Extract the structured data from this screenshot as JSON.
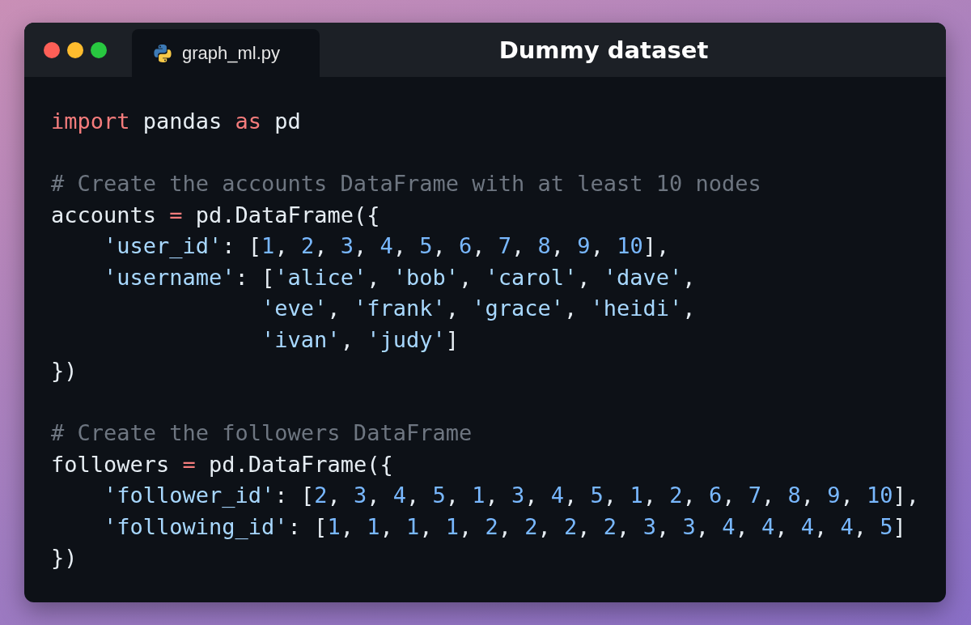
{
  "window": {
    "title": "Dummy dataset",
    "tab": {
      "label": "graph_ml.py"
    }
  },
  "code": [
    {
      "kind": "code",
      "tokens": [
        {
          "kind": "keyword",
          "text": "import"
        },
        {
          "kind": "plain",
          "text": " pandas "
        },
        {
          "kind": "keyword",
          "text": "as"
        },
        {
          "kind": "plain",
          "text": " pd"
        }
      ]
    },
    {
      "kind": "blank"
    },
    {
      "kind": "code",
      "tokens": [
        {
          "kind": "comment",
          "text": "# Create the accounts DataFrame with at least 10 nodes"
        }
      ]
    },
    {
      "kind": "code",
      "tokens": [
        {
          "kind": "plain",
          "text": "accounts "
        },
        {
          "kind": "operator",
          "text": "="
        },
        {
          "kind": "plain",
          "text": " pd.DataFrame({"
        }
      ]
    },
    {
      "kind": "nested",
      "tokens": [
        {
          "kind": "string",
          "text": "'user_id'"
        },
        {
          "kind": "plain",
          "text": ": ["
        },
        {
          "kind": "number",
          "text": "1"
        },
        {
          "kind": "plain",
          "text": ", "
        },
        {
          "kind": "number",
          "text": "2"
        },
        {
          "kind": "plain",
          "text": ", "
        },
        {
          "kind": "number",
          "text": "3"
        },
        {
          "kind": "plain",
          "text": ", "
        },
        {
          "kind": "number",
          "text": "4"
        },
        {
          "kind": "plain",
          "text": ", "
        },
        {
          "kind": "number",
          "text": "5"
        },
        {
          "kind": "plain",
          "text": ", "
        },
        {
          "kind": "number",
          "text": "6"
        },
        {
          "kind": "plain",
          "text": ", "
        },
        {
          "kind": "number",
          "text": "7"
        },
        {
          "kind": "plain",
          "text": ", "
        },
        {
          "kind": "number",
          "text": "8"
        },
        {
          "kind": "plain",
          "text": ", "
        },
        {
          "kind": "number",
          "text": "9"
        },
        {
          "kind": "plain",
          "text": ", "
        },
        {
          "kind": "number",
          "text": "10"
        },
        {
          "kind": "plain",
          "text": "],"
        }
      ]
    },
    {
      "kind": "nested",
      "tokens": [
        {
          "kind": "string",
          "text": "'username'"
        },
        {
          "kind": "plain",
          "text": ": ["
        },
        {
          "kind": "string",
          "text": "'alice'"
        },
        {
          "kind": "plain",
          "text": ", "
        },
        {
          "kind": "string",
          "text": "'bob'"
        },
        {
          "kind": "plain",
          "text": ", "
        },
        {
          "kind": "string",
          "text": "'carol'"
        },
        {
          "kind": "plain",
          "text": ", "
        },
        {
          "kind": "string",
          "text": "'dave'"
        },
        {
          "kind": "plain",
          "text": ","
        }
      ]
    },
    {
      "kind": "continued",
      "tokens": [
        {
          "kind": "string",
          "text": "'eve'"
        },
        {
          "kind": "plain",
          "text": ", "
        },
        {
          "kind": "string",
          "text": "'frank'"
        },
        {
          "kind": "plain",
          "text": ", "
        },
        {
          "kind": "string",
          "text": "'grace'"
        },
        {
          "kind": "plain",
          "text": ", "
        },
        {
          "kind": "string",
          "text": "'heidi'"
        },
        {
          "kind": "plain",
          "text": ","
        }
      ]
    },
    {
      "kind": "continued",
      "tokens": [
        {
          "kind": "string",
          "text": "'ivan'"
        },
        {
          "kind": "plain",
          "text": ", "
        },
        {
          "kind": "string",
          "text": "'judy'"
        },
        {
          "kind": "plain",
          "text": "]"
        }
      ]
    },
    {
      "kind": "code",
      "tokens": [
        {
          "kind": "plain",
          "text": "})"
        }
      ]
    },
    {
      "kind": "blank"
    },
    {
      "kind": "code",
      "tokens": [
        {
          "kind": "comment",
          "text": "# Create the followers DataFrame"
        }
      ]
    },
    {
      "kind": "code",
      "tokens": [
        {
          "kind": "plain",
          "text": "followers "
        },
        {
          "kind": "operator",
          "text": "="
        },
        {
          "kind": "plain",
          "text": " pd.DataFrame({"
        }
      ]
    },
    {
      "kind": "nested",
      "tokens": [
        {
          "kind": "string",
          "text": "'follower_id'"
        },
        {
          "kind": "plain",
          "text": ": ["
        },
        {
          "kind": "number",
          "text": "2"
        },
        {
          "kind": "plain",
          "text": ", "
        },
        {
          "kind": "number",
          "text": "3"
        },
        {
          "kind": "plain",
          "text": ", "
        },
        {
          "kind": "number",
          "text": "4"
        },
        {
          "kind": "plain",
          "text": ", "
        },
        {
          "kind": "number",
          "text": "5"
        },
        {
          "kind": "plain",
          "text": ", "
        },
        {
          "kind": "number",
          "text": "1"
        },
        {
          "kind": "plain",
          "text": ", "
        },
        {
          "kind": "number",
          "text": "3"
        },
        {
          "kind": "plain",
          "text": ", "
        },
        {
          "kind": "number",
          "text": "4"
        },
        {
          "kind": "plain",
          "text": ", "
        },
        {
          "kind": "number",
          "text": "5"
        },
        {
          "kind": "plain",
          "text": ", "
        },
        {
          "kind": "number",
          "text": "1"
        },
        {
          "kind": "plain",
          "text": ", "
        },
        {
          "kind": "number",
          "text": "2"
        },
        {
          "kind": "plain",
          "text": ", "
        },
        {
          "kind": "number",
          "text": "6"
        },
        {
          "kind": "plain",
          "text": ", "
        },
        {
          "kind": "number",
          "text": "7"
        },
        {
          "kind": "plain",
          "text": ", "
        },
        {
          "kind": "number",
          "text": "8"
        },
        {
          "kind": "plain",
          "text": ", "
        },
        {
          "kind": "number",
          "text": "9"
        },
        {
          "kind": "plain",
          "text": ", "
        },
        {
          "kind": "number",
          "text": "10"
        },
        {
          "kind": "plain",
          "text": "],"
        }
      ]
    },
    {
      "kind": "nested",
      "tokens": [
        {
          "kind": "string",
          "text": "'following_id'"
        },
        {
          "kind": "plain",
          "text": ": ["
        },
        {
          "kind": "number",
          "text": "1"
        },
        {
          "kind": "plain",
          "text": ", "
        },
        {
          "kind": "number",
          "text": "1"
        },
        {
          "kind": "plain",
          "text": ", "
        },
        {
          "kind": "number",
          "text": "1"
        },
        {
          "kind": "plain",
          "text": ", "
        },
        {
          "kind": "number",
          "text": "1"
        },
        {
          "kind": "plain",
          "text": ", "
        },
        {
          "kind": "number",
          "text": "2"
        },
        {
          "kind": "plain",
          "text": ", "
        },
        {
          "kind": "number",
          "text": "2"
        },
        {
          "kind": "plain",
          "text": ", "
        },
        {
          "kind": "number",
          "text": "2"
        },
        {
          "kind": "plain",
          "text": ", "
        },
        {
          "kind": "number",
          "text": "2"
        },
        {
          "kind": "plain",
          "text": ", "
        },
        {
          "kind": "number",
          "text": "3"
        },
        {
          "kind": "plain",
          "text": ", "
        },
        {
          "kind": "number",
          "text": "3"
        },
        {
          "kind": "plain",
          "text": ", "
        },
        {
          "kind": "number",
          "text": "4"
        },
        {
          "kind": "plain",
          "text": ", "
        },
        {
          "kind": "number",
          "text": "4"
        },
        {
          "kind": "plain",
          "text": ", "
        },
        {
          "kind": "number",
          "text": "4"
        },
        {
          "kind": "plain",
          "text": ", "
        },
        {
          "kind": "number",
          "text": "4"
        },
        {
          "kind": "plain",
          "text": ", "
        },
        {
          "kind": "number",
          "text": "5"
        },
        {
          "kind": "plain",
          "text": "]"
        }
      ]
    },
    {
      "kind": "code",
      "tokens": [
        {
          "kind": "plain",
          "text": "})"
        }
      ]
    }
  ]
}
